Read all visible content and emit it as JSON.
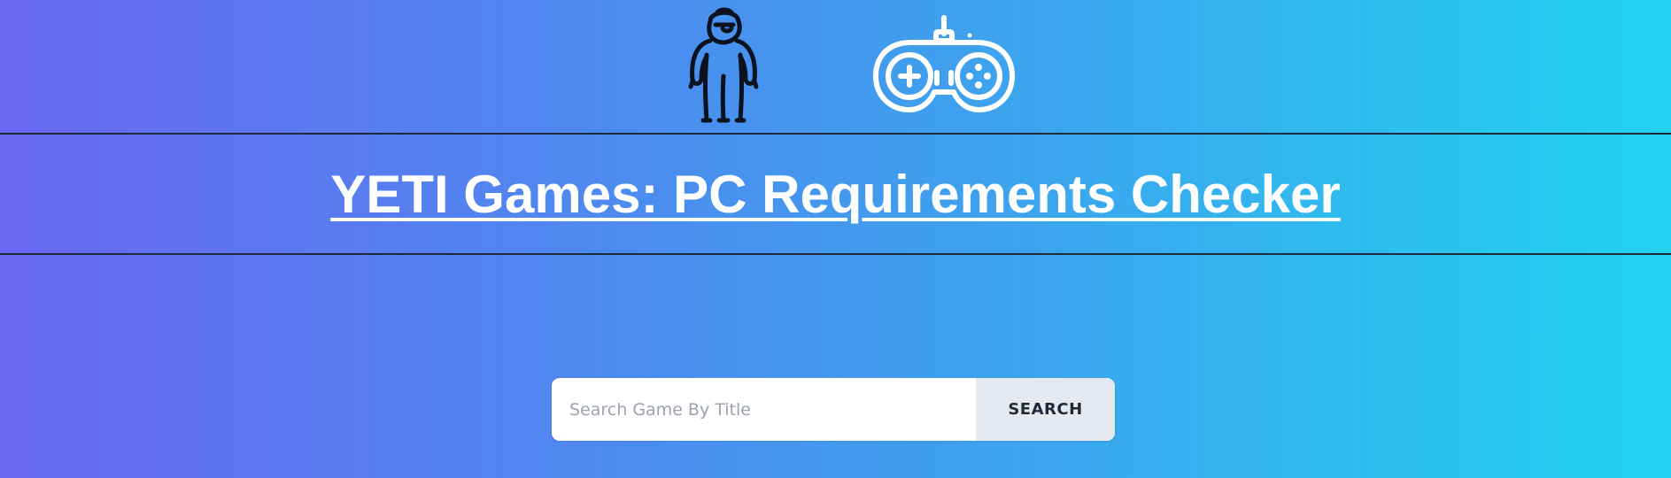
{
  "header": {
    "icons": {
      "mascot": "yeti-icon",
      "controller": "gamepad-icon"
    },
    "title": "YETI Games: PC Requirements Checker"
  },
  "search": {
    "placeholder": "Search Game By Title",
    "value": "",
    "button_label": "SEARCH"
  },
  "colors": {
    "gradient_start": "#6a67f2",
    "gradient_end": "#22d3ee",
    "title_text": "#ffffff",
    "button_bg": "#e5e9f0",
    "button_text": "#1f2937"
  }
}
